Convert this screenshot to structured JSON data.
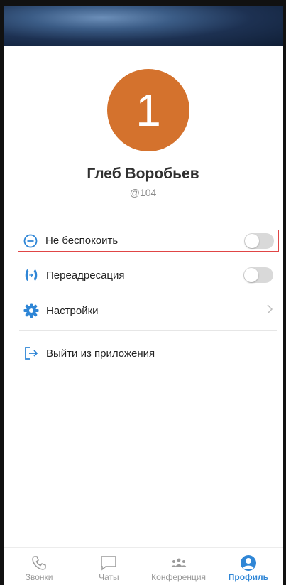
{
  "profile": {
    "avatar_text": "1",
    "name": "Глеб Воробьев",
    "username": "@104"
  },
  "menu": {
    "dnd_label": "Не беспокоить",
    "forward_label": "Переадресация",
    "settings_label": "Настройки",
    "logout_label": "Выйти из приложения"
  },
  "tabs": {
    "calls": "Звонки",
    "chats": "Чаты",
    "conferences": "Конференция",
    "profile": "Профиль"
  },
  "colors": {
    "accent": "#2f86d6",
    "avatar": "#d4722d",
    "highlight": "#e04545"
  },
  "icons": {
    "dnd": "minus-circle-icon",
    "forward": "call-forward-icon",
    "settings": "gear-icon",
    "logout": "logout-icon",
    "calls_tab": "phone-icon",
    "chats_tab": "chat-bubble-icon",
    "conferences_tab": "group-icon",
    "profile_tab": "user-circle-icon"
  }
}
